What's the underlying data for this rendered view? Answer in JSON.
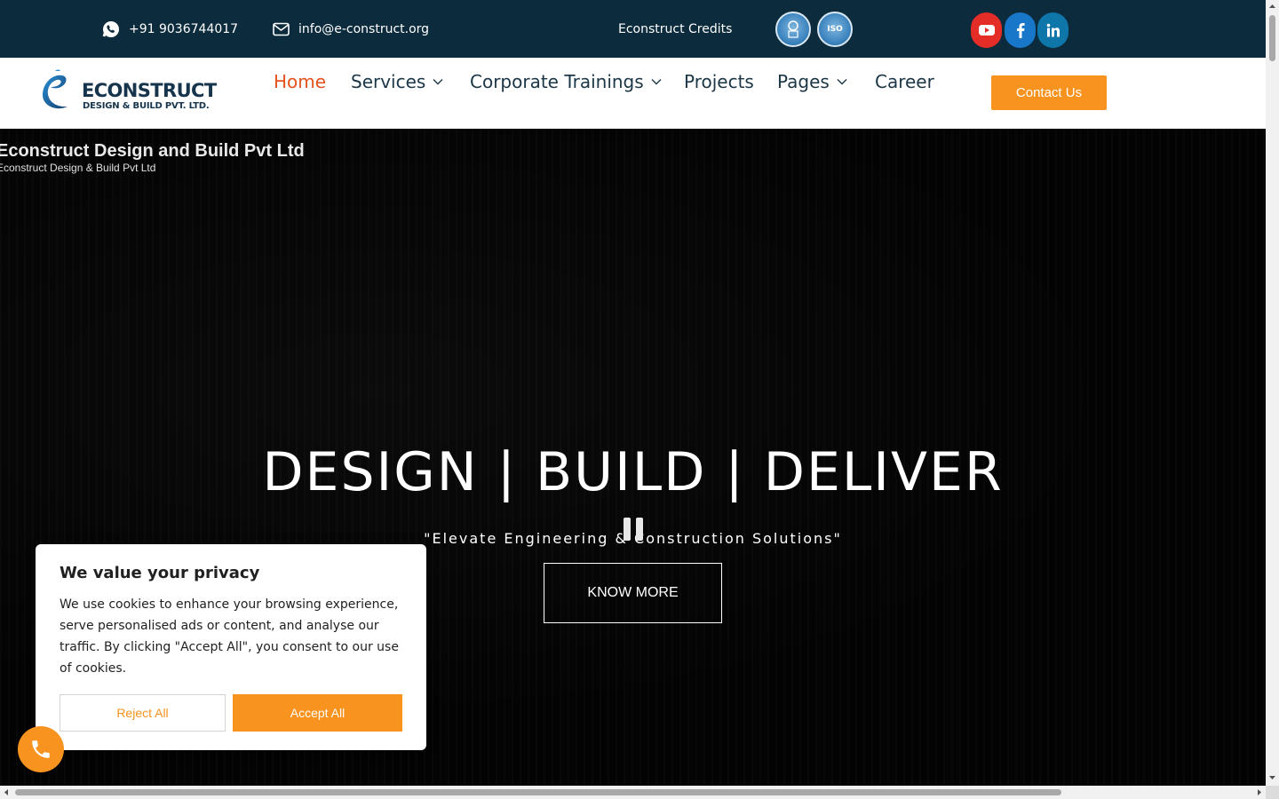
{
  "topbar": {
    "phone": "+91 9036744017",
    "email": "info@e-construct.org",
    "credits": "Econstruct Credits",
    "badge1": "",
    "badge2": "ISO",
    "social": [
      "youtube-icon",
      "facebook-icon",
      "linkedin-icon"
    ]
  },
  "logo": {
    "name": "ECONSTRUCT",
    "sub": "DESIGN & BUILD PVT. LTD."
  },
  "nav": {
    "items": [
      {
        "label": "Home",
        "dropdown": false,
        "active": true
      },
      {
        "label": "Services",
        "dropdown": true,
        "active": false
      },
      {
        "label": "Corporate Trainings",
        "dropdown": true,
        "active": false
      },
      {
        "label": "Projects",
        "dropdown": false,
        "active": false
      },
      {
        "label": "Pages",
        "dropdown": true,
        "active": false
      },
      {
        "label": "Career",
        "dropdown": false,
        "active": false
      }
    ],
    "contact_label": "Contact Us"
  },
  "hero": {
    "video_title": "Econstruct Design and Build Pvt Ltd",
    "video_subtitle": "Econstruct Design & Build Pvt Ltd",
    "title": "DESIGN | BUILD | DELIVER",
    "tagline": "\"Elevate Engineering & Construction Solutions\"",
    "cta": "KNOW MORE"
  },
  "cookie": {
    "title": "We value your privacy",
    "text": "We use cookies to enhance your browsing experience, serve personalised ads or content, and analyse our traffic. By clicking \"Accept All\", you consent to our use of cookies.",
    "reject": "Reject All",
    "accept": "Accept All"
  },
  "colors": {
    "topbar_bg": "#0c2b3c",
    "accent_orange": "#f7931e",
    "nav_active": "#e5521d",
    "nav_text": "#1b3647",
    "youtube": "#e52d27",
    "facebook": "#1877c8",
    "linkedin": "#0e76a8"
  }
}
